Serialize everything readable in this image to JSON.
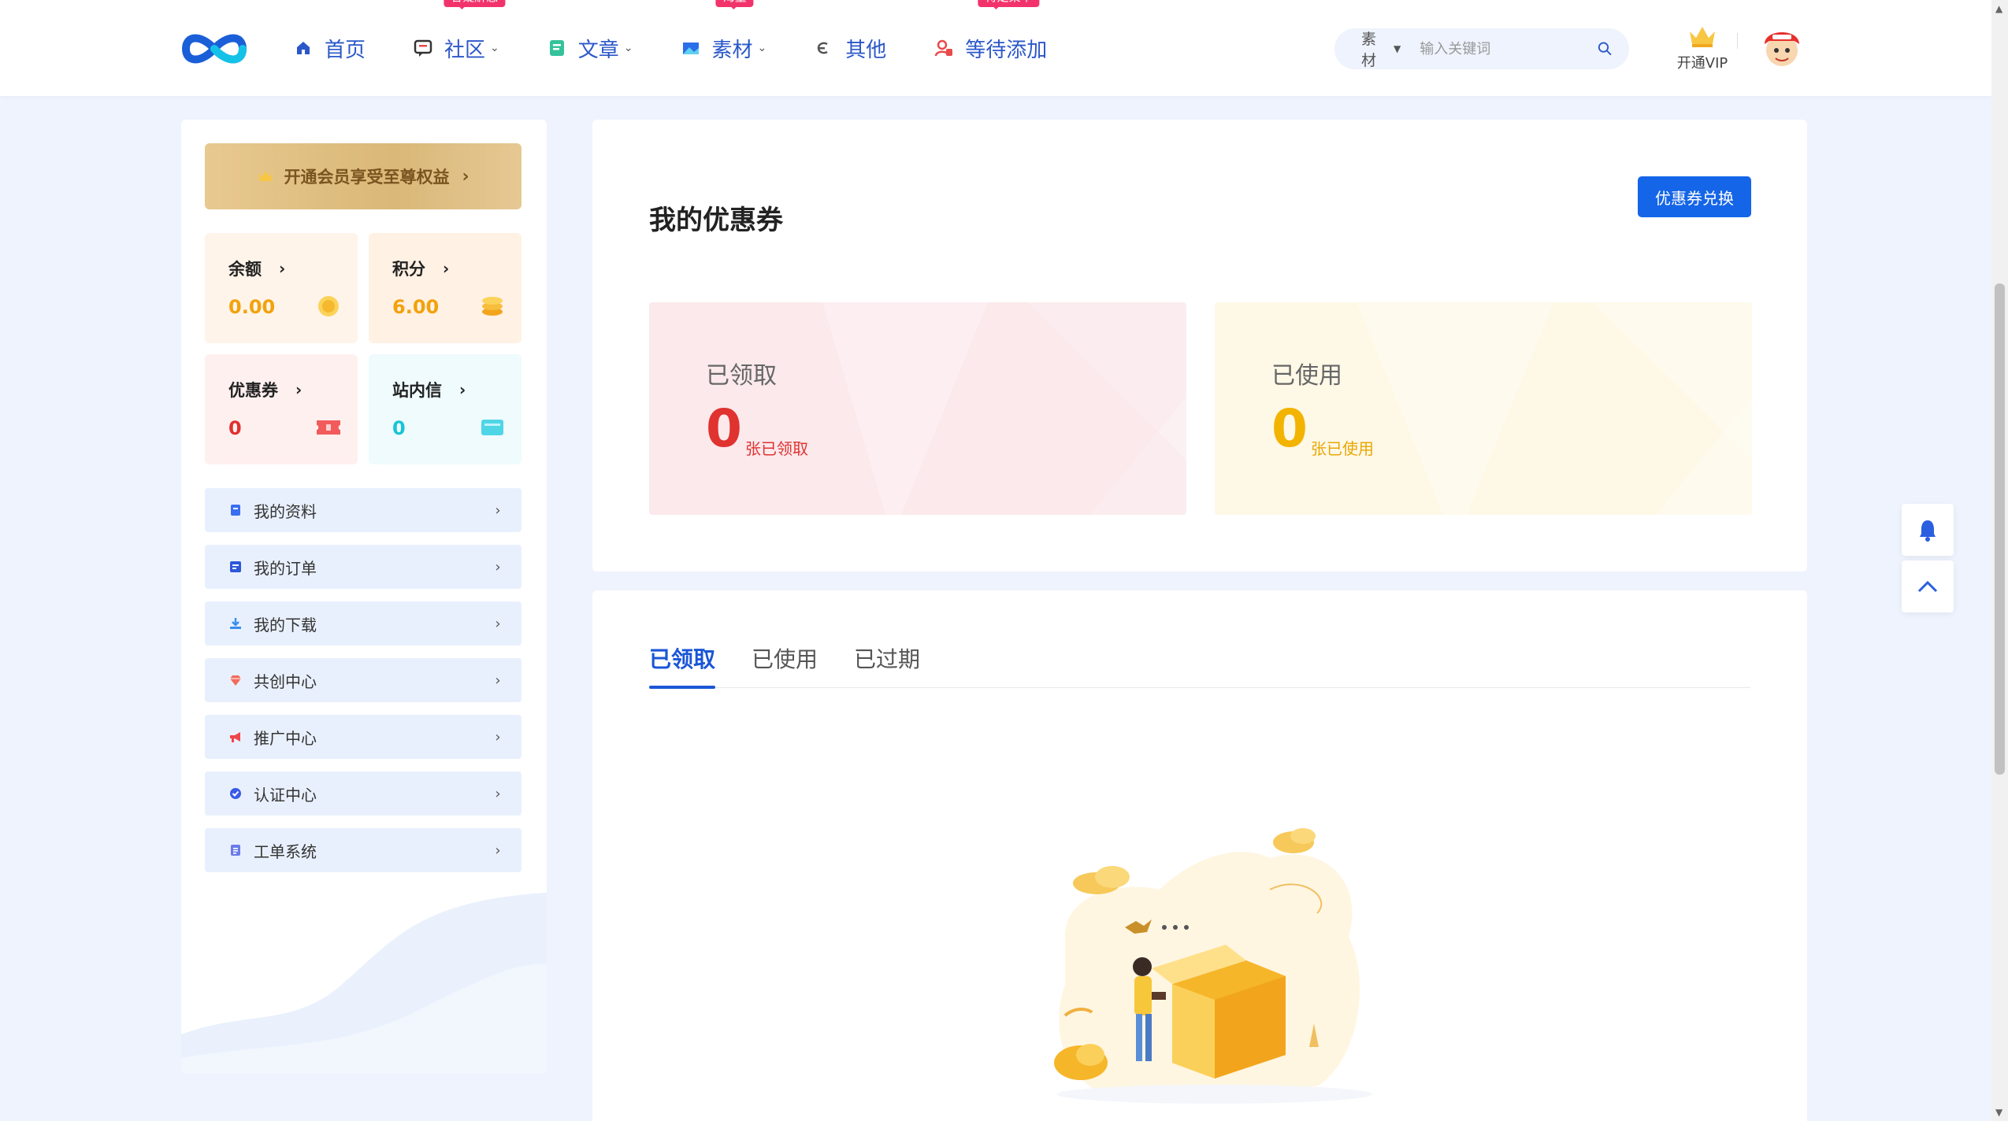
{
  "header": {
    "nav": [
      {
        "label": "首页",
        "icon": "home-icon",
        "badge": "",
        "dropdown": false
      },
      {
        "label": "社区",
        "icon": "community-icon",
        "badge": "答疑解惑",
        "dropdown": true
      },
      {
        "label": "文章",
        "icon": "article-icon",
        "badge": "",
        "dropdown": true
      },
      {
        "label": "素材",
        "icon": "material-icon",
        "badge": "海量",
        "dropdown": true
      },
      {
        "label": "其他",
        "icon": "other-icon",
        "badge": "",
        "dropdown": false
      },
      {
        "label": "等待添加",
        "icon": "pending-icon",
        "badge": "待定菜单",
        "dropdown": false
      }
    ],
    "search": {
      "category": "素材",
      "placeholder": "输入关键词"
    },
    "vip_label": "开通VIP"
  },
  "sidebar": {
    "vip_banner": "开通会员享受至尊权益",
    "stats": {
      "balance": {
        "label": "余额",
        "value": "0.00",
        "color": "#f2a20c"
      },
      "points": {
        "label": "积分",
        "value": "6.00",
        "color": "#f2a20c"
      },
      "coupons": {
        "label": "优惠券",
        "value": "0",
        "color": "#e0322f"
      },
      "messages": {
        "label": "站内信",
        "value": "0",
        "color": "#17c4d6"
      }
    },
    "menu": [
      {
        "label": "我的资料",
        "icon": "profile-icon"
      },
      {
        "label": "我的订单",
        "icon": "order-icon"
      },
      {
        "label": "我的下载",
        "icon": "download-icon"
      },
      {
        "label": "共创中心",
        "icon": "cocreate-icon"
      },
      {
        "label": "推广中心",
        "icon": "promotion-icon"
      },
      {
        "label": "认证中心",
        "icon": "certification-icon"
      },
      {
        "label": "工单系统",
        "icon": "ticket-icon"
      }
    ]
  },
  "main": {
    "title": "我的优惠券",
    "redeem_button": "优惠券兑换",
    "received": {
      "label": "已领取",
      "count": "0",
      "unit": "张已领取"
    },
    "used": {
      "label": "已使用",
      "count": "0",
      "unit": "张已使用"
    },
    "tabs": [
      "已领取",
      "已使用",
      "已过期"
    ],
    "active_tab": 0
  },
  "colors": {
    "accent": "#1565e8",
    "nav": "#2b57c9",
    "badge": "#f2336b",
    "page_bg": "#eef3fd"
  }
}
